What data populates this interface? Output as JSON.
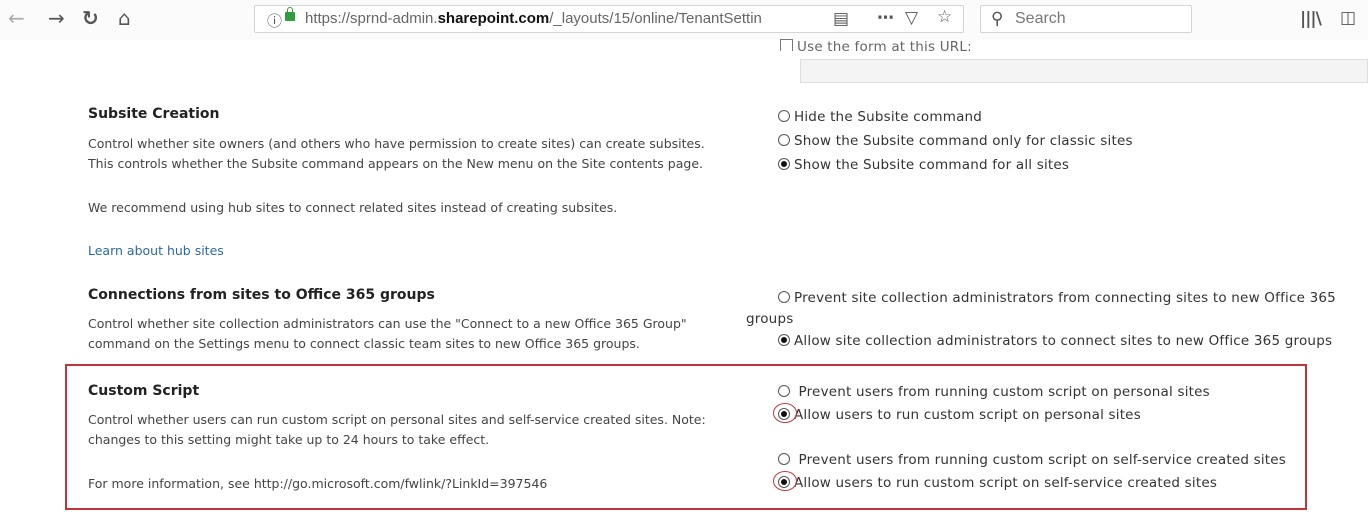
{
  "browser": {
    "url_prefix": "https://sprnd-admin.",
    "url_domain": "sharepoint.com",
    "url_path": "/_layouts/15/online/TenantSettin",
    "search_placeholder": "Search"
  },
  "top_partial": {
    "checkbox_label": "Use the form at this URL:",
    "url_value": ""
  },
  "subsite": {
    "title": "Subsite Creation",
    "desc1": "Control whether site owners (and others who have permission to create sites) can create subsites.",
    "desc2": "This controls whether the Subsite command appears on the New menu on the Site contents page.",
    "desc3": "We recommend using hub sites to connect related sites instead of creating subsites.",
    "link": "Learn about hub sites",
    "options": [
      {
        "label": "Hide the Subsite command",
        "selected": false
      },
      {
        "label": "Show the Subsite command only for classic sites",
        "selected": false
      },
      {
        "label": "Show the Subsite command for all sites",
        "selected": true
      }
    ]
  },
  "connections": {
    "title": "Connections from sites to Office 365 groups",
    "desc1": "Control whether site collection administrators can use the \"Connect to a new Office 365 Group\"",
    "desc2": "command on the Settings menu to connect classic team sites to new Office 365 groups.",
    "options": [
      {
        "label_line1": "Prevent site collection administrators from connecting sites to new Office 365",
        "label_line2": "groups",
        "selected": false
      },
      {
        "label": "Allow site collection administrators to connect sites to new Office 365 groups",
        "selected": true
      }
    ]
  },
  "custom_script": {
    "title": "Custom Script",
    "desc1": "Control whether users can run custom script on personal sites and self-service created sites.  Note:",
    "desc2": "changes to this setting might take up to 24 hours to take effect.",
    "desc3": "For more information, see http://go.microsoft.com/fwlink/?LinkId=397546",
    "options": [
      {
        "label": "Prevent users from running custom script on personal sites",
        "selected": false
      },
      {
        "label": "Allow users to run custom script on personal sites",
        "selected": true
      },
      {
        "label": "Prevent users from running custom script on self-service created sites",
        "selected": false
      },
      {
        "label": "Allow users to run custom script on self-service created sites",
        "selected": true
      }
    ]
  },
  "colors": {
    "highlight": "#c0343e",
    "link": "#2b6aa0"
  }
}
